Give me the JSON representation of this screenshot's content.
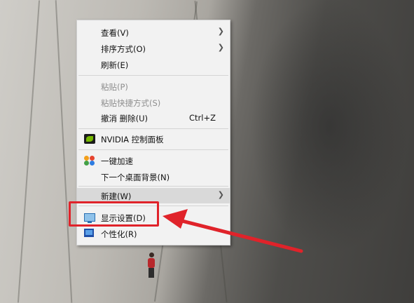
{
  "context_menu": {
    "items": [
      {
        "label": "查看(V)"
      },
      {
        "label": "排序方式(O)"
      },
      {
        "label": "刷新(E)"
      },
      {
        "label": "粘贴(P)"
      },
      {
        "label": "粘贴快捷方式(S)"
      },
      {
        "label": "撤消 删除(U)",
        "shortcut": "Ctrl+Z"
      },
      {
        "label": "NVIDIA 控制面板"
      },
      {
        "label": "一键加速"
      },
      {
        "label": "下一个桌面背景(N)"
      },
      {
        "label": "新建(W)"
      },
      {
        "label": "显示设置(D)"
      },
      {
        "label": "个性化(R)"
      }
    ],
    "submenu_arrow": "❯"
  },
  "watermark": "",
  "colors": {
    "highlight": "#e0232a",
    "menu_bg": "#f2f2f2",
    "hover_bg": "#d9d9d9"
  }
}
